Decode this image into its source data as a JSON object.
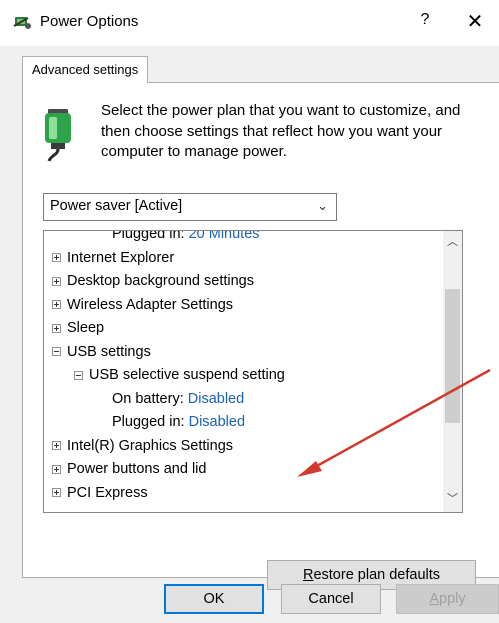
{
  "window": {
    "title": "Power Options",
    "help_label": "?",
    "close_label": "✕"
  },
  "tab": {
    "label": "Advanced settings"
  },
  "description": "Select the power plan that you want to customize, and then choose settings that reflect how you want your computer to manage power.",
  "plan_select": {
    "value": "Power saver [Active]"
  },
  "tree": {
    "items": [
      {
        "kind": "value",
        "label": "Plugged in:",
        "value": "20 Minutes"
      },
      {
        "kind": "group",
        "label": "Internet Explorer",
        "expanded": false
      },
      {
        "kind": "group",
        "label": "Desktop background settings",
        "expanded": false
      },
      {
        "kind": "group",
        "label": "Wireless Adapter Settings",
        "expanded": false
      },
      {
        "kind": "group",
        "label": "Sleep",
        "expanded": false
      },
      {
        "kind": "group",
        "label": "USB settings",
        "expanded": true
      },
      {
        "kind": "subgroup",
        "label": "USB selective suspend setting",
        "expanded": true
      },
      {
        "kind": "value",
        "label": "On battery:",
        "value": "Disabled"
      },
      {
        "kind": "value",
        "label": "Plugged in:",
        "value": "Disabled"
      },
      {
        "kind": "group",
        "label": "Intel(R) Graphics Settings",
        "expanded": false
      },
      {
        "kind": "group",
        "label": "Power buttons and lid",
        "expanded": false
      },
      {
        "kind": "group",
        "label": "PCI Express",
        "expanded": false
      }
    ]
  },
  "buttons": {
    "restore_label": "Restore plan defaults",
    "ok_label": "OK",
    "cancel_label": "Cancel",
    "apply_label": "Apply"
  },
  "colors": {
    "value_link": "#1a62b4",
    "annotation_arrow": "#d0392b",
    "focus_border": "#0078d7"
  },
  "icons": {
    "app": "power-options-icon",
    "battery": "battery-plug-icon"
  }
}
